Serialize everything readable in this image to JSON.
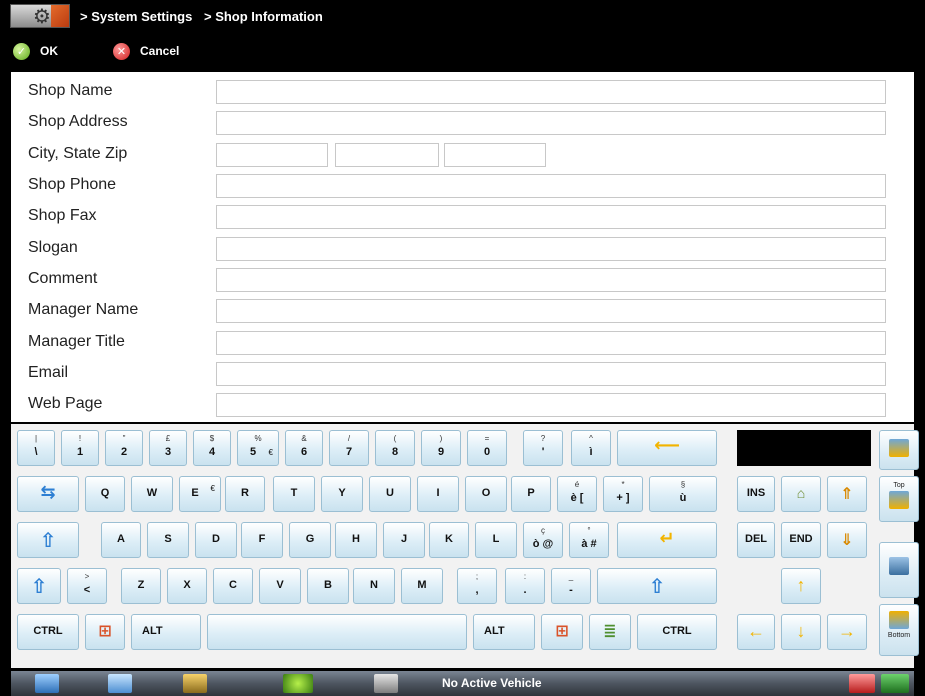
{
  "header": {
    "breadcrumb": [
      "> System Settings",
      "> Shop Information"
    ],
    "ok_label": "OK",
    "cancel_label": "Cancel"
  },
  "form": {
    "fields": [
      {
        "label": "Shop Name",
        "value": ""
      },
      {
        "label": "Shop Address",
        "value": ""
      },
      {
        "label": "City, State Zip",
        "value": ""
      },
      {
        "label": "Shop Phone",
        "value": ""
      },
      {
        "label": "Shop Fax",
        "value": ""
      },
      {
        "label": "Slogan",
        "value": ""
      },
      {
        "label": "Comment",
        "value": ""
      },
      {
        "label": "Manager Name",
        "value": ""
      },
      {
        "label": "Manager Title",
        "value": ""
      },
      {
        "label": "Email",
        "value": ""
      },
      {
        "label": "Web Page",
        "value": ""
      }
    ]
  },
  "keyboard": {
    "row1": [
      {
        "main": "\\",
        "top": "|"
      },
      {
        "main": "1",
        "top": "!"
      },
      {
        "main": "2",
        "top": "\""
      },
      {
        "main": "3",
        "top": "£"
      },
      {
        "main": "4",
        "top": "$"
      },
      {
        "main": "5",
        "top": "%",
        "alt": "€"
      },
      {
        "main": "6",
        "top": "&"
      },
      {
        "main": "7",
        "top": "/"
      },
      {
        "main": "8",
        "top": "("
      },
      {
        "main": "9",
        "top": ")"
      },
      {
        "main": "0",
        "top": "="
      },
      {
        "main": "'",
        "top": "?"
      },
      {
        "main": "ì",
        "top": "^"
      }
    ],
    "row2": [
      "Q",
      "W",
      "E",
      "R",
      "T",
      "Y",
      "U",
      "I",
      "O",
      "P"
    ],
    "row2_alt_e": "€",
    "row2_extra": [
      {
        "main": "è [",
        "top": "é"
      },
      {
        "main": "+ ]",
        "top": "*"
      },
      {
        "main": "ù",
        "top": "§"
      }
    ],
    "row3": [
      "A",
      "S",
      "D",
      "F",
      "G",
      "H",
      "J",
      "K",
      "L"
    ],
    "row3_extra": [
      {
        "main": "ò @",
        "top": "ç"
      },
      {
        "main": "à #",
        "top": "°"
      }
    ],
    "row4_first": {
      "main": "<",
      "top": ">"
    },
    "row4": [
      "Z",
      "X",
      "C",
      "V",
      "B",
      "N",
      "M"
    ],
    "row4_extra": [
      {
        "main": ",",
        "top": ";"
      },
      {
        "main": ".",
        "top": ":"
      },
      {
        "main": "-",
        "top": "_"
      }
    ],
    "ctrl_label": "CTRL",
    "alt_label": "ALT",
    "nav": {
      "ins_label": "INS",
      "del_label": "DEL",
      "end_label": "END",
      "top_label": "Top",
      "bottom_label": "Bottom"
    }
  },
  "taskbar": {
    "status": "No Active Vehicle"
  }
}
